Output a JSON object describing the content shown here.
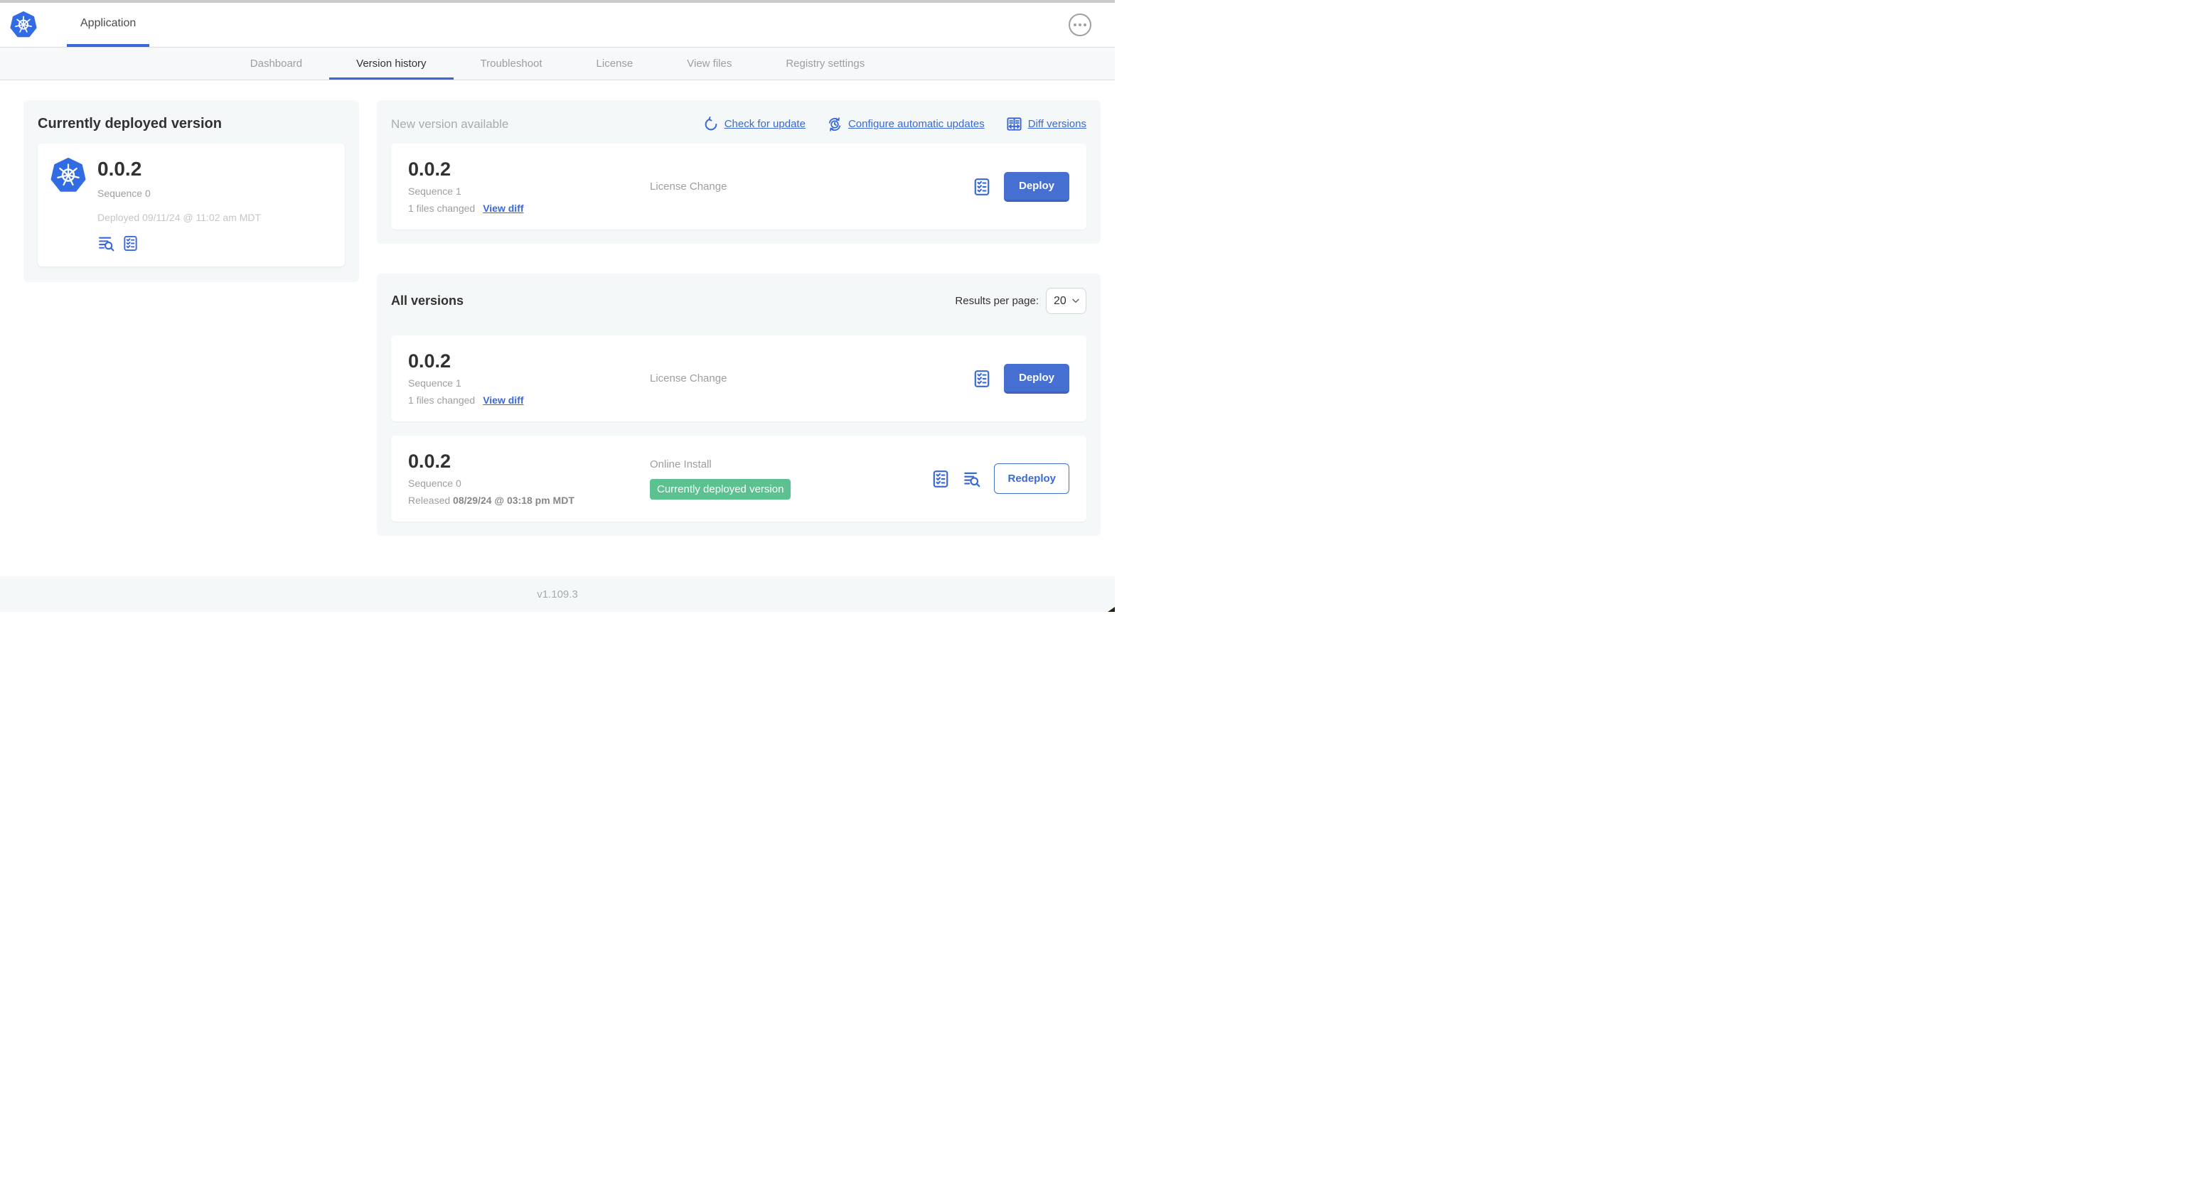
{
  "header": {
    "app_tab": "Application"
  },
  "nav": {
    "tabs": [
      {
        "label": "Dashboard"
      },
      {
        "label": "Version history"
      },
      {
        "label": "Troubleshoot"
      },
      {
        "label": "License"
      },
      {
        "label": "View files"
      },
      {
        "label": "Registry settings"
      }
    ]
  },
  "current_deployed": {
    "title": "Currently deployed version",
    "version": "0.0.2",
    "sequence": "Sequence 0",
    "deployed_at": "Deployed 09/11/24 @ 11:02 am MDT"
  },
  "new_version": {
    "title": "New version available",
    "links": {
      "check": "Check for update",
      "configure": "Configure automatic updates",
      "diff": "Diff versions"
    },
    "row": {
      "version": "0.0.2",
      "sequence": "Sequence 1",
      "files_changed": "1 files changed",
      "view_diff": "View diff",
      "source": "License Change",
      "deploy_label": "Deploy"
    }
  },
  "all_versions": {
    "title": "All versions",
    "results_per_page_label": "Results per page:",
    "results_per_page_value": "20",
    "rows": [
      {
        "version": "0.0.2",
        "sequence": "Sequence 1",
        "files_changed": "1 files changed",
        "view_diff": "View diff",
        "source": "License Change",
        "deploy_label": "Deploy"
      },
      {
        "version": "0.0.2",
        "sequence": "Sequence 0",
        "released_prefix": "Released",
        "released_date": "08/29/24 @ 03:18 pm MDT",
        "source": "Online Install",
        "badge": "Currently deployed version",
        "redeploy_label": "Redeploy"
      }
    ]
  },
  "footer": {
    "version": "v1.109.3"
  },
  "colors": {
    "accent_blue": "#3a68d8",
    "button_blue": "#4570d2",
    "badge_green": "#5cc191",
    "panel_gray": "#f5f8f9",
    "kubernetes_blue": "#326ce5"
  }
}
